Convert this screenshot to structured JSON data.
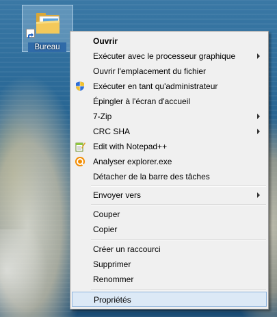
{
  "desktop": {
    "icon_label": "Bureau",
    "icon_name": "folder-icon"
  },
  "context_menu": {
    "items": [
      {
        "label": "Ouvrir",
        "bold": true
      },
      {
        "label": "Exécuter avec le processeur graphique",
        "submenu": true
      },
      {
        "label": "Ouvrir l'emplacement du fichier"
      },
      {
        "label": "Exécuter en tant qu'administrateur",
        "icon": "uac-shield-icon"
      },
      {
        "label": "Épingler à l'écran d'accueil"
      },
      {
        "label": "7-Zip",
        "submenu": true
      },
      {
        "label": "CRC SHA",
        "submenu": true
      },
      {
        "label": "Edit with Notepad++",
        "icon": "notepad-plus-plus-icon"
      },
      {
        "label": "Analyser explorer.exe",
        "icon": "antivirus-scan-icon"
      },
      {
        "label": "Détacher de la barre des tâches"
      },
      {
        "label": "Envoyer vers",
        "submenu": true
      },
      {
        "label": "Couper"
      },
      {
        "label": "Copier"
      },
      {
        "label": "Créer un raccourci"
      },
      {
        "label": "Supprimer"
      },
      {
        "label": "Renommer"
      },
      {
        "label": "Propriétés",
        "highlighted": true
      }
    ]
  },
  "colors": {
    "menu_background": "#f0f0f0",
    "highlight_background": "#dce9f6",
    "highlight_border": "#8fb4dd",
    "icon_selection": "#2f6aa8"
  }
}
